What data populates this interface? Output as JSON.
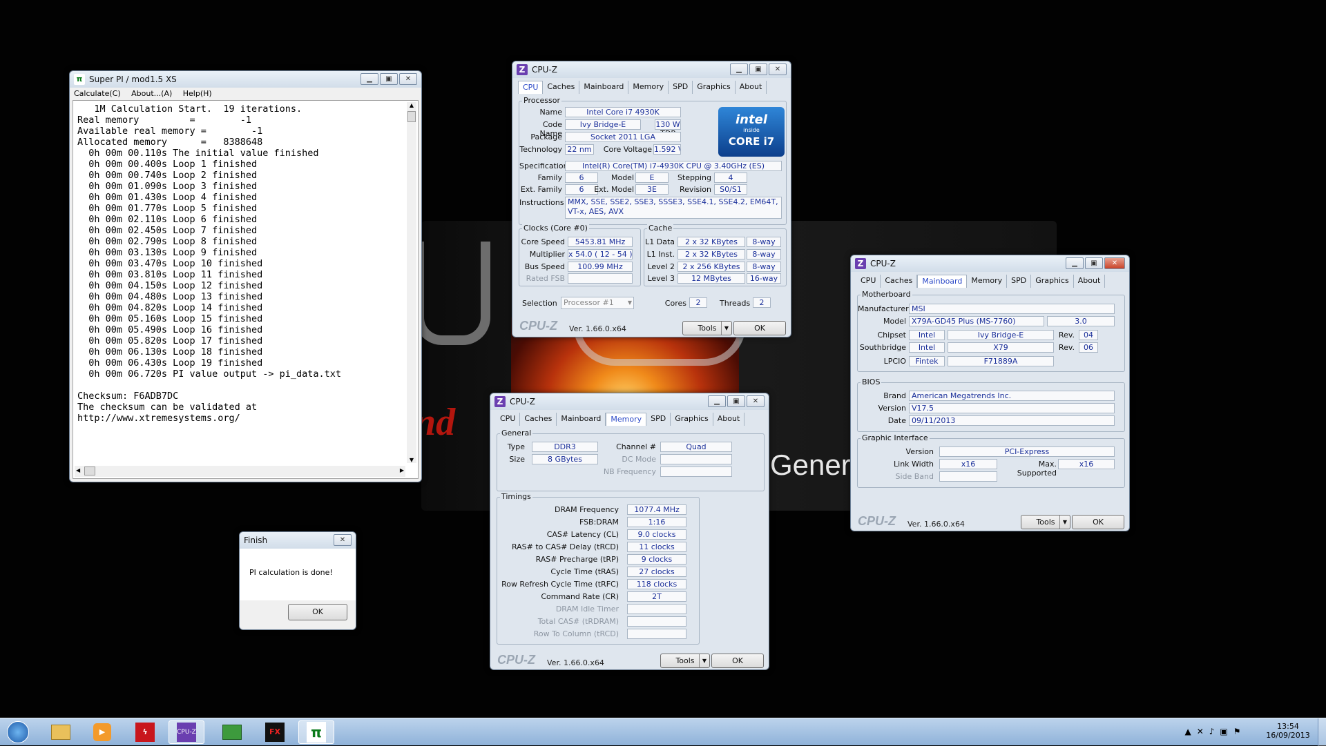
{
  "superpi": {
    "title": "Super PI / mod1.5 XS",
    "menu": [
      "Calculate(C)",
      "About...(A)",
      "Help(H)"
    ],
    "lines": [
      "   1M Calculation Start.  19 iterations.",
      "Real memory         =        -1",
      "Available real memory =        -1",
      "Allocated memory      =   8388648",
      "  0h 00m 00.110s The initial value finished",
      "  0h 00m 00.400s Loop 1 finished",
      "  0h 00m 00.740s Loop 2 finished",
      "  0h 00m 01.090s Loop 3 finished",
      "  0h 00m 01.430s Loop 4 finished",
      "  0h 00m 01.770s Loop 5 finished",
      "  0h 00m 02.110s Loop 6 finished",
      "  0h 00m 02.450s Loop 7 finished",
      "  0h 00m 02.790s Loop 8 finished",
      "  0h 00m 03.130s Loop 9 finished",
      "  0h 00m 03.470s Loop 10 finished",
      "  0h 00m 03.810s Loop 11 finished",
      "  0h 00m 04.150s Loop 12 finished",
      "  0h 00m 04.480s Loop 13 finished",
      "  0h 00m 04.820s Loop 14 finished",
      "  0h 00m 05.160s Loop 15 finished",
      "  0h 00m 05.490s Loop 16 finished",
      "  0h 00m 05.820s Loop 17 finished",
      "  0h 00m 06.130s Loop 18 finished",
      "  0h 00m 06.430s Loop 19 finished",
      "  0h 00m 06.720s PI value output -> pi_data.txt",
      "",
      "Checksum: F6ADB7DC",
      "The checksum can be validated at",
      "http://www.xtremesystems.org/"
    ]
  },
  "finish": {
    "title": "Finish",
    "message": "PI calculation is done!",
    "ok": "OK"
  },
  "cpuz_common": {
    "title": "CPU-Z",
    "tabs": [
      "CPU",
      "Caches",
      "Mainboard",
      "Memory",
      "SPD",
      "Graphics",
      "About"
    ],
    "logo": "CPU-Z",
    "version": "Ver. 1.66.0.x64",
    "tools": "Tools",
    "ok": "OK"
  },
  "cpu": {
    "processor_group": "Processor",
    "name_label": "Name",
    "name": "Intel Core i7 4930K",
    "codename_label": "Code Name",
    "codename": "Ivy Bridge-E",
    "maxtdp_label": "Max TDP",
    "maxtdp": "130 W",
    "package_label": "Package",
    "package": "Socket 2011 LGA",
    "technology_label": "Technology",
    "technology": "22 nm",
    "corevoltage_label": "Core Voltage",
    "corevoltage": "1.592 V",
    "spec_label": "Specification",
    "spec": "Intel(R) Core(TM) i7-4930K CPU @ 3.40GHz (ES)",
    "family_label": "Family",
    "family": "6",
    "model_label": "Model",
    "model": "E",
    "stepping_label": "Stepping",
    "stepping": "4",
    "extfamily_label": "Ext. Family",
    "extfamily": "6",
    "extmodel_label": "Ext. Model",
    "extmodel": "3E",
    "revision_label": "Revision",
    "revision": "S0/S1",
    "instr_label": "Instructions",
    "instr1": "MMX, SSE, SSE2, SSE3, SSSE3, SSE4.1, SSE4.2, EM64T,",
    "instr2": "VT-x, AES, AVX",
    "clocks_group": "Clocks (Core #0)",
    "corespeed_label": "Core Speed",
    "corespeed": "5453.81 MHz",
    "multiplier_label": "Multiplier",
    "multiplier": "x 54.0 ( 12 - 54 )",
    "busspeed_label": "Bus Speed",
    "busspeed": "100.99 MHz",
    "ratedfsb_label": "Rated FSB",
    "cache_group": "Cache",
    "l1d_label": "L1 Data",
    "l1d": "2 x 32 KBytes",
    "l1d_way": "8-way",
    "l1i_label": "L1 Inst.",
    "l1i": "2 x 32 KBytes",
    "l1i_way": "8-way",
    "l2_label": "Level 2",
    "l2": "2 x 256 KBytes",
    "l2_way": "8-way",
    "l3_label": "Level 3",
    "l3": "12 MBytes",
    "l3_way": "16-way",
    "selection_label": "Selection",
    "selection": "Processor #1",
    "cores_label": "Cores",
    "cores": "2",
    "threads_label": "Threads",
    "threads": "2",
    "intel_brand": "intel",
    "intel_inside": "inside",
    "intel_core": "CORE i7"
  },
  "mem": {
    "general_group": "General",
    "type_label": "Type",
    "type": "DDR3",
    "size_label": "Size",
    "size": "8 GBytes",
    "channel_label": "Channel #",
    "channel": "Quad",
    "dcmode_label": "DC Mode",
    "nbfreq_label": "NB Frequency",
    "timings_group": "Timings",
    "dram_label": "DRAM Frequency",
    "dram": "1077.4 MHz",
    "fsb_label": "FSB:DRAM",
    "fsb": "1:16",
    "cl_label": "CAS# Latency (CL)",
    "cl": "9.0 clocks",
    "trcd_label": "RAS# to CAS# Delay (tRCD)",
    "trcd": "11 clocks",
    "trp_label": "RAS# Precharge (tRP)",
    "trp": "9 clocks",
    "tras_label": "Cycle Time (tRAS)",
    "tras": "27 clocks",
    "trfc_label": "Row Refresh Cycle Time (tRFC)",
    "trfc": "118 clocks",
    "cr_label": "Command Rate (CR)",
    "cr": "2T",
    "idle_label": "DRAM Idle Timer",
    "trdram_label": "Total CAS# (tRDRAM)",
    "rtc_label": "Row To Column (tRCD)"
  },
  "mb": {
    "mb_group": "Motherboard",
    "manufacturer_label": "Manufacturer",
    "manufacturer": "MSI",
    "model_label": "Model",
    "model": "X79A-GD45 Plus (MS-7760)",
    "model_rev": "3.0",
    "chipset_label": "Chipset",
    "chipset_vendor": "Intel",
    "chipset": "Ivy Bridge-E",
    "rev_label": "Rev.",
    "chipset_rev": "04",
    "south_label": "Southbridge",
    "south_vendor": "Intel",
    "south": "X79",
    "south_rev": "06",
    "lpcio_label": "LPCIO",
    "lpcio_vendor": "Fintek",
    "lpcio": "F71889A",
    "bios_group": "BIOS",
    "brand_label": "Brand",
    "brand": "American Megatrends Inc.",
    "version_label": "Version",
    "version": "V17.5",
    "date_label": "Date",
    "date": "09/11/2013",
    "gi_group": "Graphic Interface",
    "giver_label": "Version",
    "giver": "PCI-Express",
    "linkwidth_label": "Link Width",
    "linkwidth": "x16",
    "maxsup_label": "Max. Supported",
    "maxsup": "x16",
    "sideband_label": "Side Band"
  },
  "taskbar": {
    "time": "13:54",
    "date": "16/09/2013"
  }
}
